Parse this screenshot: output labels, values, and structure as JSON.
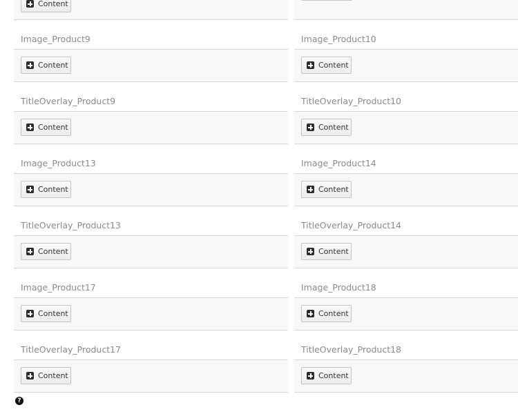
{
  "content_button_label": "Content",
  "help_icon": "question-circle-icon",
  "left_column": [
    {
      "title": "Image_Product9"
    },
    {
      "title": "TitleOverlay_Product9"
    },
    {
      "title": "Image_Product13"
    },
    {
      "title": "TitleOverlay_Product13"
    },
    {
      "title": "Image_Product17"
    },
    {
      "title": "TitleOverlay_Product17"
    }
  ],
  "right_column": [
    {
      "title": "Image_Product10"
    },
    {
      "title": "TitleOverlay_Product10"
    },
    {
      "title": "Image_Product14"
    },
    {
      "title": "TitleOverlay_Product14"
    },
    {
      "title": "Image_Product18"
    },
    {
      "title": "TitleOverlay_Product18"
    }
  ]
}
